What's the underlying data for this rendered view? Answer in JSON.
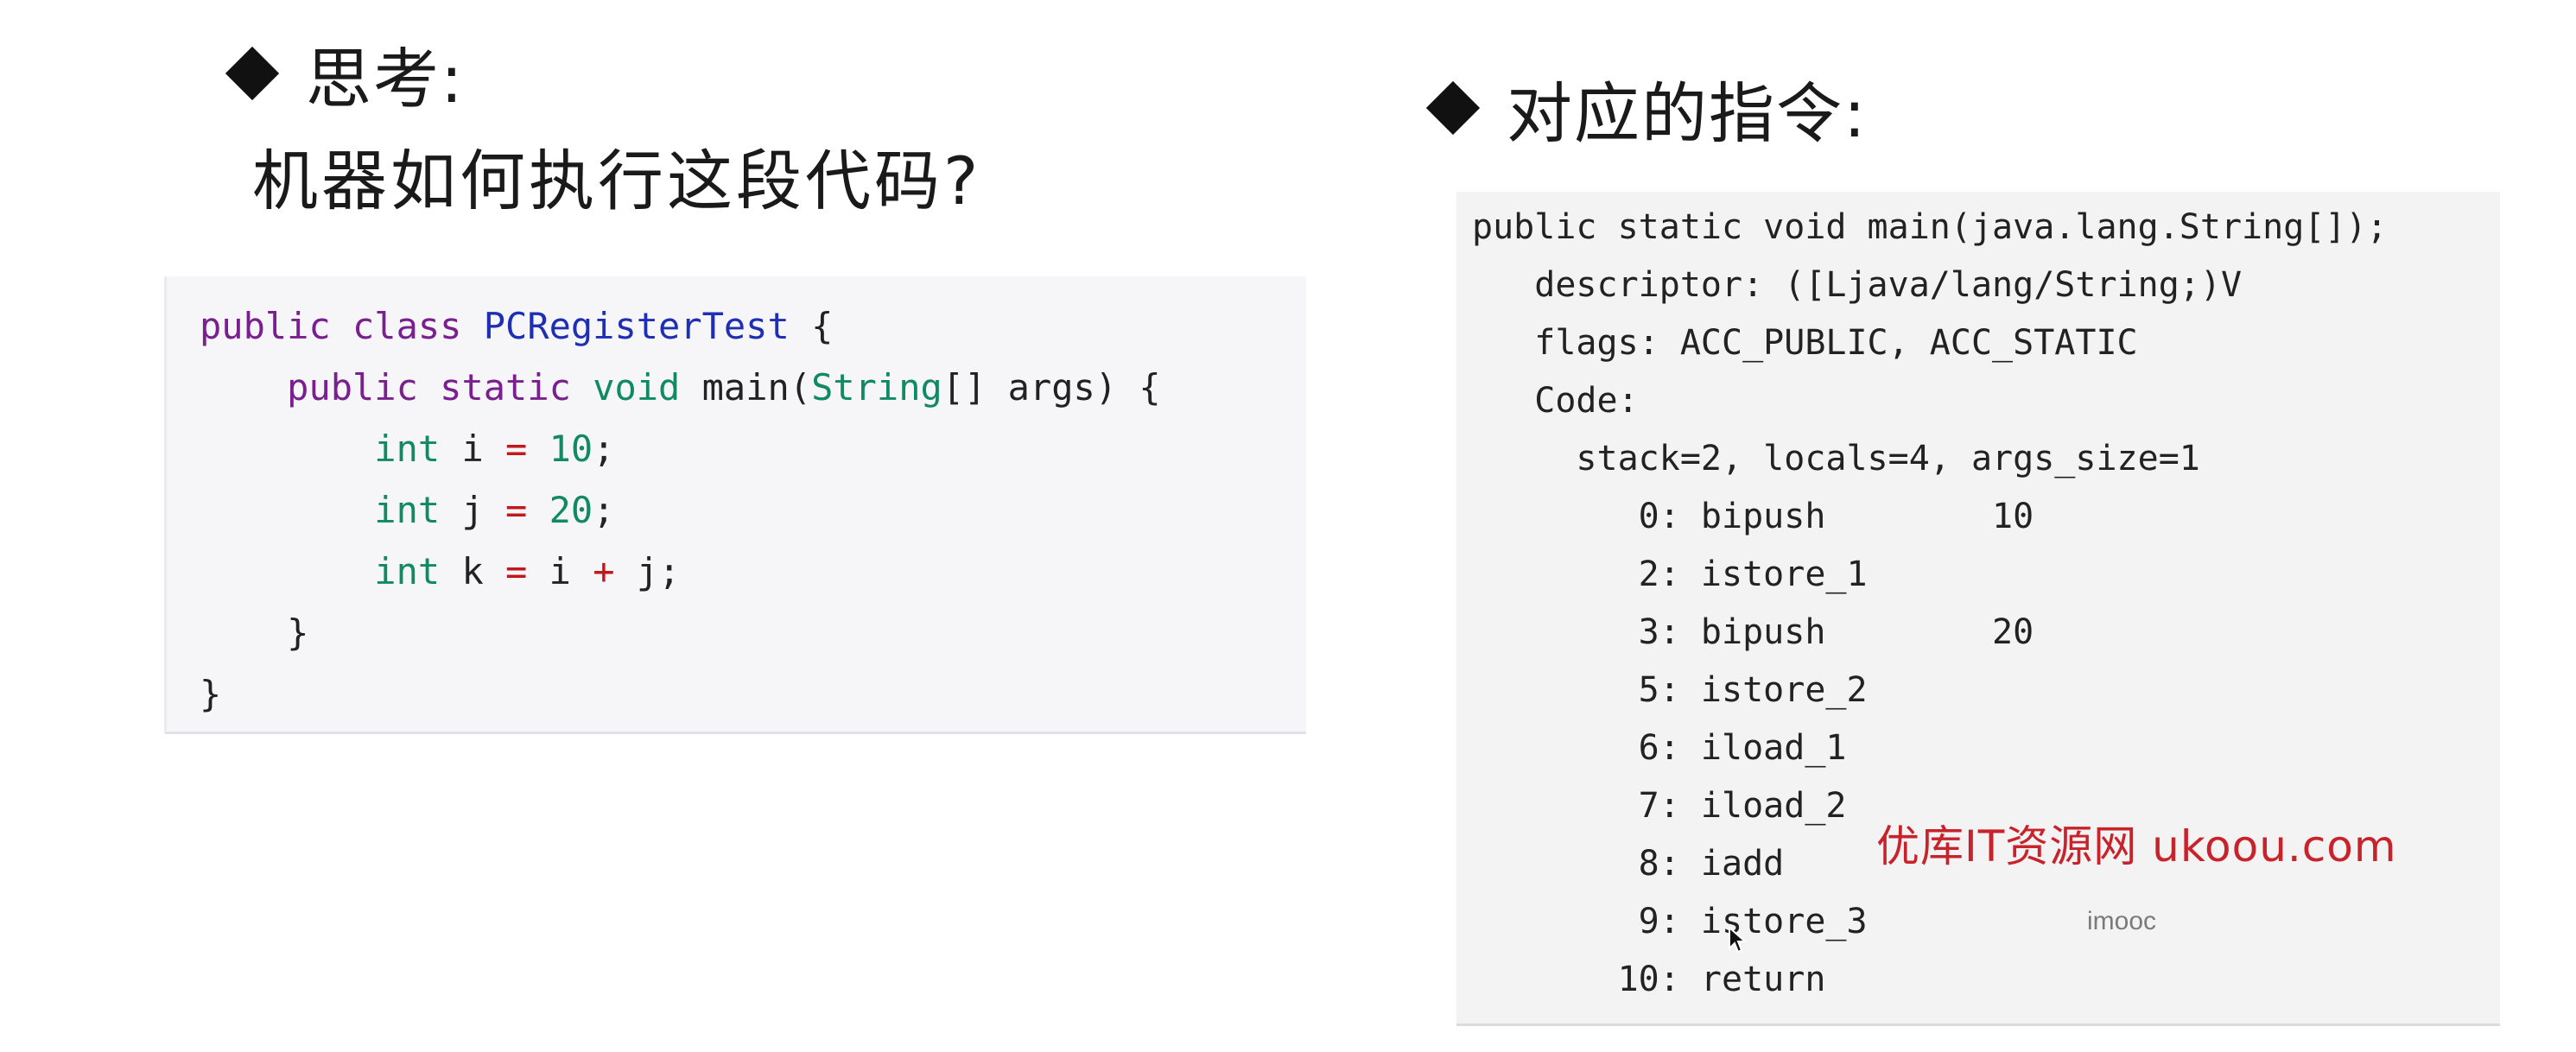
{
  "left": {
    "heading": "思考:",
    "subheading": "机器如何执行这段代码?"
  },
  "right": {
    "heading": "对应的指令:"
  },
  "java_code": {
    "line1": [
      "public",
      "class",
      "PCRegisterTest",
      "{"
    ],
    "line2": [
      "public",
      "static",
      "void",
      "main(",
      "String",
      "[] args) {"
    ],
    "line3": [
      "int",
      "i",
      "=",
      "10",
      ";"
    ],
    "line4": [
      "int",
      "j",
      "=",
      "20",
      ";"
    ],
    "line5": [
      "int",
      "k",
      "=",
      "i",
      "+",
      "j;"
    ],
    "line6": "}",
    "line7": "}"
  },
  "bytecode": [
    "public static void main(java.lang.String[]);",
    "   descriptor: ([Ljava/lang/String;)V",
    "   flags: ACC_PUBLIC, ACC_STATIC",
    "   Code:",
    "     stack=2, locals=4, args_size=1",
    "        0: bipush        10",
    "        2: istore_1",
    "        3: bipush        20",
    "        5: istore_2",
    "        6: iload_1",
    "        7: iload_2",
    "        8: iadd",
    "        9: istore_3",
    "       10: return"
  ],
  "watermark": "优库IT资源网 ukoou.com",
  "brand": "imooc",
  "icons": {
    "bullet": "diamond-icon",
    "cursor": "cursor-icon"
  }
}
